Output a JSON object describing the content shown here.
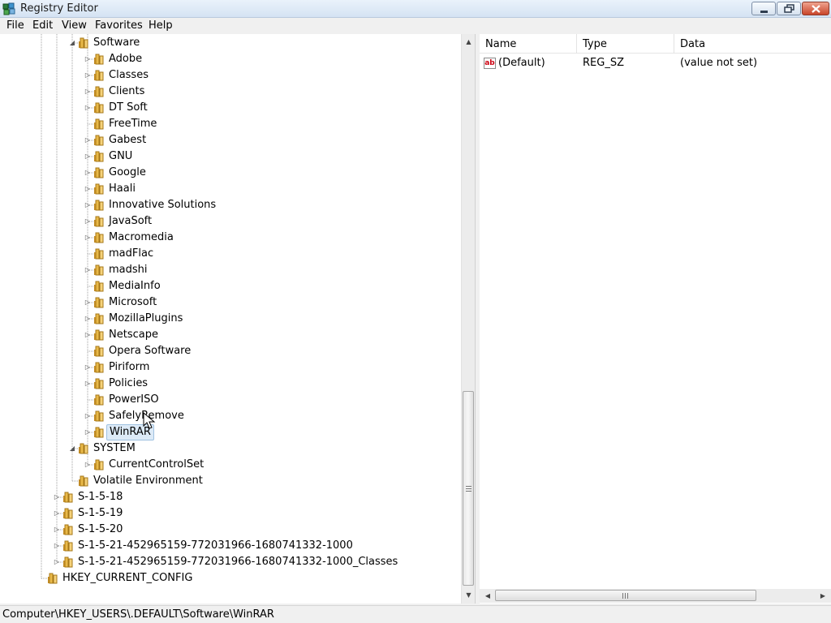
{
  "window": {
    "title": "Registry Editor",
    "icon": "registry-editor-icon"
  },
  "menu": [
    "File",
    "Edit",
    "View",
    "Favorites",
    "Help"
  ],
  "tree": [
    {
      "label": "Software",
      "expander": "expanded",
      "level": 2
    },
    {
      "label": "Adobe",
      "expander": "collapsed",
      "level": 3
    },
    {
      "label": "Classes",
      "expander": "collapsed",
      "level": 3
    },
    {
      "label": "Clients",
      "expander": "collapsed",
      "level": 3
    },
    {
      "label": "DT Soft",
      "expander": "collapsed",
      "level": 3
    },
    {
      "label": "FreeTime",
      "expander": "none",
      "level": 3
    },
    {
      "label": "Gabest",
      "expander": "collapsed",
      "level": 3
    },
    {
      "label": "GNU",
      "expander": "collapsed",
      "level": 3
    },
    {
      "label": "Google",
      "expander": "collapsed",
      "level": 3
    },
    {
      "label": "Haali",
      "expander": "collapsed",
      "level": 3
    },
    {
      "label": "Innovative Solutions",
      "expander": "collapsed",
      "level": 3
    },
    {
      "label": "JavaSoft",
      "expander": "collapsed",
      "level": 3
    },
    {
      "label": "Macromedia",
      "expander": "collapsed",
      "level": 3
    },
    {
      "label": "madFlac",
      "expander": "none",
      "level": 3
    },
    {
      "label": "madshi",
      "expander": "collapsed",
      "level": 3
    },
    {
      "label": "MediaInfo",
      "expander": "none",
      "level": 3
    },
    {
      "label": "Microsoft",
      "expander": "collapsed",
      "level": 3
    },
    {
      "label": "MozillaPlugins",
      "expander": "collapsed",
      "level": 3
    },
    {
      "label": "Netscape",
      "expander": "collapsed",
      "level": 3
    },
    {
      "label": "Opera Software",
      "expander": "none",
      "level": 3
    },
    {
      "label": "Piriform",
      "expander": "collapsed",
      "level": 3
    },
    {
      "label": "Policies",
      "expander": "collapsed",
      "level": 3
    },
    {
      "label": "PowerISO",
      "expander": "none",
      "level": 3
    },
    {
      "label": "SafelyRemove",
      "expander": "collapsed",
      "level": 3
    },
    {
      "label": "WinRAR",
      "expander": "collapsed",
      "level": 3,
      "selected": true
    },
    {
      "label": "SYSTEM",
      "expander": "expanded",
      "level": 2
    },
    {
      "label": "CurrentControlSet",
      "expander": "collapsed",
      "level": 3
    },
    {
      "label": "Volatile Environment",
      "expander": "none",
      "level": 2
    },
    {
      "label": "S-1-5-18",
      "expander": "collapsed",
      "level": 1
    },
    {
      "label": "S-1-5-19",
      "expander": "collapsed",
      "level": 1
    },
    {
      "label": "S-1-5-20",
      "expander": "collapsed",
      "level": 1
    },
    {
      "label": "S-1-5-21-452965159-772031966-1680741332-1000",
      "expander": "collapsed",
      "level": 1
    },
    {
      "label": "S-1-5-21-452965159-772031966-1680741332-1000_Classes",
      "expander": "collapsed",
      "level": 1
    },
    {
      "label": "HKEY_CURRENT_CONFIG",
      "expander": "none",
      "level": 0
    }
  ],
  "list": {
    "columns": [
      "Name",
      "Type",
      "Data"
    ],
    "rows": [
      {
        "icon": "string-value-icon",
        "name": "(Default)",
        "type": "REG_SZ",
        "data": "(value not set)"
      }
    ]
  },
  "status": {
    "path": "Computer\\HKEY_USERS\\.DEFAULT\\Software\\WinRAR"
  },
  "colors": {
    "selection": "#dceaf7",
    "folder": "#e9b949",
    "titlebar": "#dbe7f4"
  }
}
